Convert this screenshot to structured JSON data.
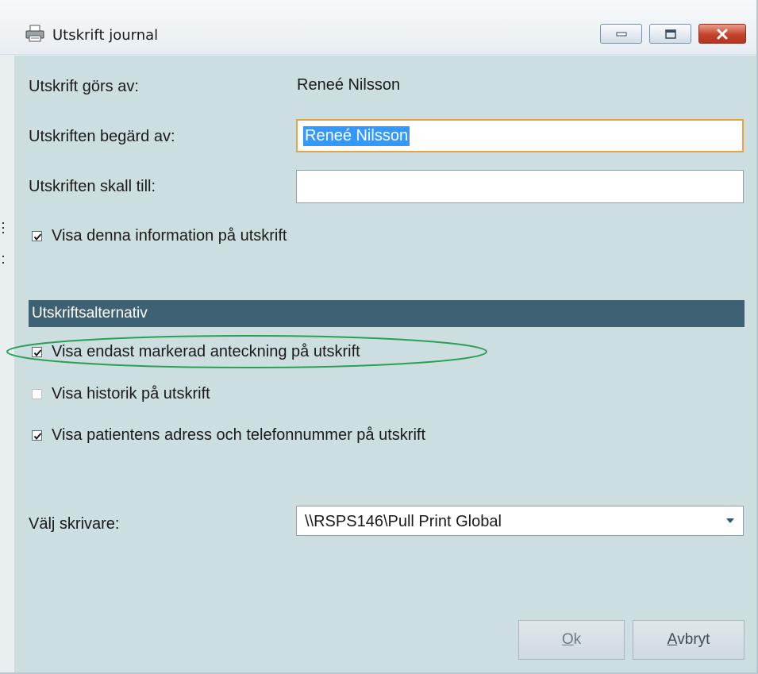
{
  "window": {
    "title": "Utskrift journal",
    "controls": [
      "minimize",
      "maximize",
      "close"
    ]
  },
  "form": {
    "printed_by_label": "Utskrift görs av:",
    "printed_by_value": "Reneé Nilsson",
    "requested_by_label": "Utskriften begärd av:",
    "requested_by_value": "Reneé Nilsson",
    "recipient_label": "Utskriften skall till:",
    "recipient_value": "",
    "show_info_label": "Visa denna information på utskrift",
    "show_info_checked": true
  },
  "options": {
    "header": "Utskriftsalternativ",
    "items": [
      {
        "label": "Visa endast markerad anteckning på utskrift",
        "checked": true,
        "highlighted": true
      },
      {
        "label": "Visa historik på utskrift",
        "checked": false
      },
      {
        "label": "Visa patientens adress och telefonnummer på utskrift",
        "checked": true
      }
    ]
  },
  "printer": {
    "label": "Välj skrivare:",
    "selected": "\\\\RSPS146\\Pull Print Global"
  },
  "buttons": {
    "ok_mnemonic": "O",
    "ok_rest": "k",
    "ok_enabled": false,
    "cancel_mnemonic": "A",
    "cancel_rest": "vbryt"
  },
  "colors": {
    "panel_bg": "#cddee0",
    "section_header_bg": "#3e6273",
    "focus_border": "#e8a24a",
    "selection_bg": "#3399ff",
    "highlight_ellipse": "#2aa052"
  },
  "icons": {
    "title": "printer-icon",
    "combo": "dropdown-arrow-icon"
  }
}
